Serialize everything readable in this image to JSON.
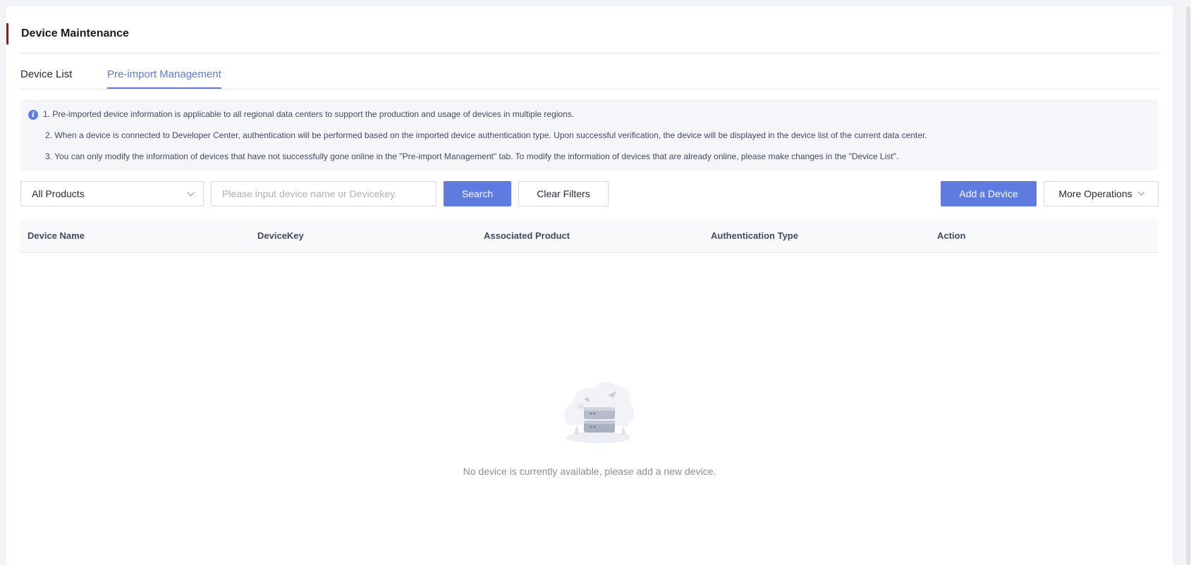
{
  "page": {
    "title": "Device Maintenance"
  },
  "tabs": [
    {
      "label": "Device List",
      "active": false
    },
    {
      "label": "Pre-import Management",
      "active": true
    }
  ],
  "notice": {
    "icon": "info-icon",
    "lines": [
      "1. Pre-imported device information is applicable to all regional data centers to support the production and usage of devices in multiple regions.",
      "2. When a device is connected to Developer Center, authentication will be performed based on the imported device authentication type. Upon successful verification, the device will be displayed in the device list of the current data center.",
      "3. You can only modify the information of devices that have not successfully gone online in the \"Pre-import Management\" tab. To modify the information of devices that are already online, please make changes in the \"Device List\"."
    ]
  },
  "filters": {
    "product_select": "All Products",
    "search_placeholder": "Please input device name or Devicekey.",
    "search_label": "Search",
    "clear_label": "Clear Filters"
  },
  "actions": {
    "add_label": "Add a Device",
    "more_label": "More Operations"
  },
  "table": {
    "columns": [
      "Device Name",
      "DeviceKey",
      "Associated Product",
      "Authentication Type",
      "Action"
    ]
  },
  "empty": {
    "message": "No device is currently available, please add a new device."
  },
  "colors": {
    "accent": "#5e7ce0",
    "brand_red": "#c7000b"
  }
}
